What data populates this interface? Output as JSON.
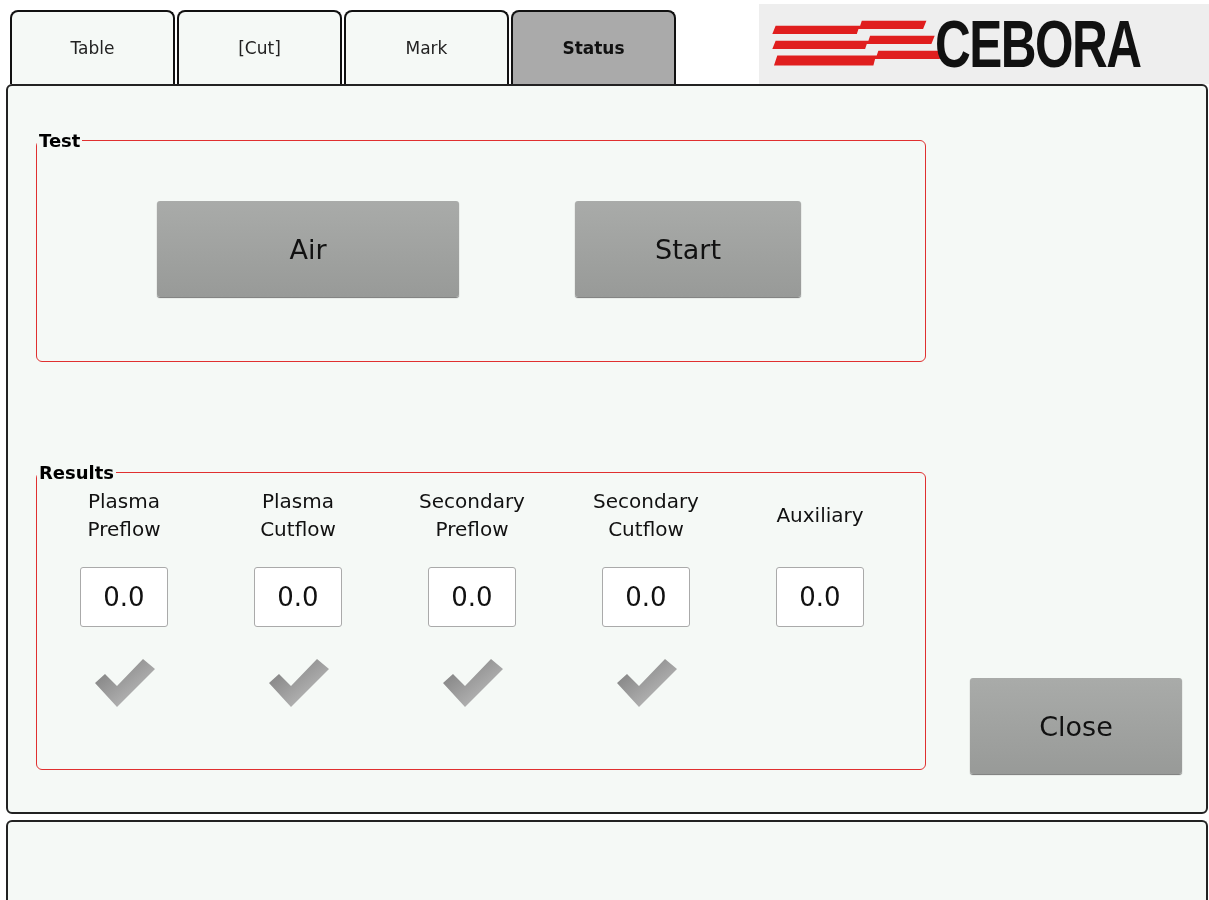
{
  "tabs": [
    {
      "label": "Table",
      "selected": false
    },
    {
      "label": "[Cut]",
      "selected": false
    },
    {
      "label": "Mark",
      "selected": false
    },
    {
      "label": "Status",
      "selected": true
    }
  ],
  "logo": {
    "text": "CEBORA"
  },
  "test": {
    "title": "Test",
    "buttons": [
      "Air",
      "Start"
    ]
  },
  "results": {
    "title": "Results",
    "items": [
      {
        "label": "Plasma Preflow",
        "value": "0.0",
        "checked": true
      },
      {
        "label": "Plasma Cutflow",
        "value": "0.0",
        "checked": true
      },
      {
        "label": "Secondary Preflow",
        "value": "0.0",
        "checked": true
      },
      {
        "label": "Secondary Cutflow",
        "value": "0.0",
        "checked": true
      },
      {
        "label": "Auxiliary",
        "value": "0.0",
        "checked": false
      }
    ]
  },
  "close_button": "Close"
}
